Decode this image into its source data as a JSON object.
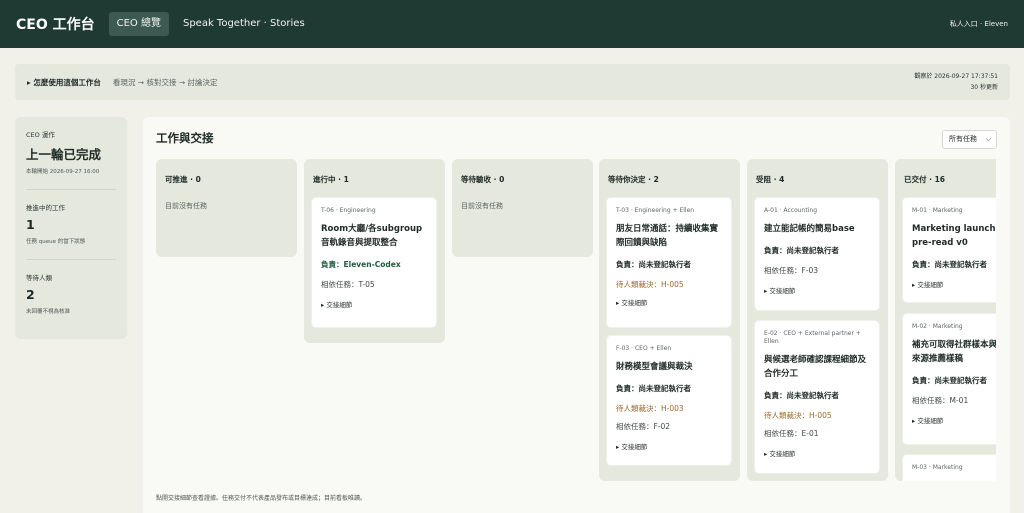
{
  "header": {
    "brand": "CEO 工作台",
    "tabs": [
      {
        "label": "CEO 總覽",
        "active": true
      },
      {
        "label": "Speak Together · Stories",
        "active": false
      }
    ],
    "right_text": "私人入口 · Eleven"
  },
  "help": {
    "toggle_label": "▸ 怎麼使用這個工作台",
    "steps": "看現況 → 核對交接 → 討論決定",
    "observed": "觀察於 2026-09-27 17:37:51",
    "refresh": "30 秒更新"
  },
  "sidebar": {
    "run_label": "CEO 運作",
    "run_status": "上一輪已完成",
    "run_started": "本輪開始 2026-09-27 16:00",
    "active_label": "推進中的工作",
    "active_count": "1",
    "active_sub": "任務 queue 的當下狀態",
    "waiting_label": "等待人類",
    "waiting_count": "2",
    "waiting_sub": "未回覆不視為核准"
  },
  "main": {
    "title": "工作與交接",
    "filter_value": "所有任務",
    "footnote": "點開交接細節查看證據。任務交付不代表產品發布或目標達成；目前看板唯讀。",
    "columns": [
      {
        "header": "可推進 · 0",
        "empty": "目前沒有任務",
        "cards": []
      },
      {
        "header": "進行中 · 1",
        "empty": "",
        "cards": [
          {
            "tag": "T-06 · Engineering",
            "title": "Room大廳/各subgroup音軌錄音與提取整合",
            "owner": "負責：Eleven-Codex",
            "pending": "",
            "dep": "相依任務：T-05",
            "details": "▸ 交接細節"
          }
        ]
      },
      {
        "header": "等待驗收 · 0",
        "empty": "目前沒有任務",
        "cards": []
      },
      {
        "header": "等待你決定 · 2",
        "empty": "",
        "cards": [
          {
            "tag": "T-03 · Engineering + Ellen",
            "title": "朋友日常通話：持續收集實際回饋與缺陷",
            "owner": "負責：尚未登記執行者",
            "pending": "待人類裁決：H-005",
            "dep": "",
            "details": "▸ 交接細節"
          },
          {
            "tag": "F-03 · CEO + Ellen",
            "title": "財務模型會議與裁決",
            "owner": "負責：尚未登記執行者",
            "pending": "待人類裁決：H-003",
            "dep": "相依任務：F-02",
            "details": "▸ 交接細節"
          }
        ]
      },
      {
        "header": "受阻 · 4",
        "empty": "",
        "cards": [
          {
            "tag": "A-01 · Accounting",
            "title": "建立能記帳的簡易base",
            "owner": "負責：尚未登記執行者",
            "pending": "",
            "dep": "相依任務：F-03",
            "details": "▸ 交接細節"
          },
          {
            "tag": "E-02 · CEO + External partner + Ellen",
            "title": "與候選老師確認課程細節及合作分工",
            "owner": "負責：尚未登記執行者",
            "pending": "待人類裁決：H-005",
            "dep": "相依任務：E-01",
            "details": "▸ 交接細節"
          }
        ]
      },
      {
        "header": "已交付 · 16",
        "empty": "",
        "cards": [
          {
            "tag": "M-01 · Marketing",
            "title": "Marketing launch pre-read v0",
            "owner": "負責：尚未登記執行者",
            "pending": "",
            "dep": "",
            "details": "▸ 交接細節"
          },
          {
            "tag": "M-02 · Marketing",
            "title": "補充可取得社群樣本與身份來源推薦樣稿",
            "owner": "負責：尚未登記執行者",
            "pending": "",
            "dep": "相依任務：M-01",
            "details": "▸ 交接細節"
          },
          {
            "tag": "M-03 · Marketing",
            "title": "",
            "owner": "",
            "pending": "",
            "dep": "",
            "details": ""
          }
        ]
      }
    ]
  }
}
